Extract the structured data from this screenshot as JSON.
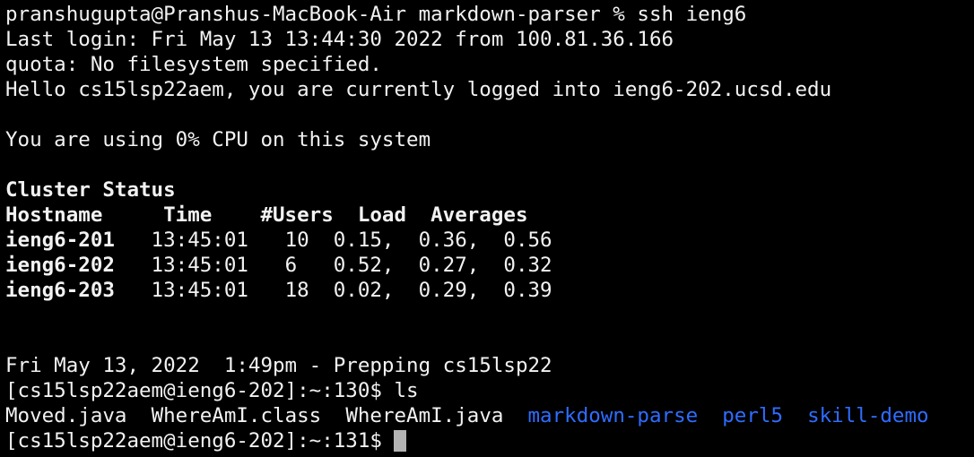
{
  "terminal": {
    "lines": {
      "ssh_cmd": "pranshugupta@Pranshus-MacBook-Air markdown-parser % ssh ieng6",
      "last_login": "Last login: Fri May 13 13:44:30 2022 from 100.81.36.166",
      "quota": "quota: No filesystem specified.",
      "hello": "Hello cs15lsp22aem, you are currently logged into ieng6-202.ucsd.edu",
      "cpu": "You are using 0% CPU on this system",
      "cluster_title": "Cluster Status",
      "cluster_header": "Hostname     Time    #Users  Load  Averages",
      "motd": "Fri May 13, 2022  1:49pm - Prepping cs15lsp22",
      "prompt_ls": "[cs15lsp22aem@ieng6-202]:~:130$ ls",
      "prompt_current": "[cs15lsp22aem@ieng6-202]:~:131$ "
    },
    "cluster_rows": [
      {
        "host": "ieng6-201",
        "rest": "   13:45:01   10  0.15,  0.36,  0.56"
      },
      {
        "host": "ieng6-202",
        "rest": "   13:45:01   6   0.52,  0.27,  0.32"
      },
      {
        "host": "ieng6-203",
        "rest": "   13:45:01   18  0.02,  0.29,  0.39"
      }
    ],
    "ls_output": {
      "files": [
        {
          "name": "Moved.java",
          "sep": "  "
        },
        {
          "name": "WhereAmI.class",
          "sep": "  "
        },
        {
          "name": "WhereAmI.java",
          "sep": "  "
        }
      ],
      "dirs": [
        {
          "name": "markdown-parse",
          "sep": "  "
        },
        {
          "name": "perl5",
          "sep": "  "
        },
        {
          "name": "skill-demo",
          "sep": ""
        }
      ]
    },
    "colors": {
      "background": "#000000",
      "foreground": "#f2f2f2",
      "directory": "#2f6cff",
      "cursor": "#b3b3b3"
    }
  }
}
